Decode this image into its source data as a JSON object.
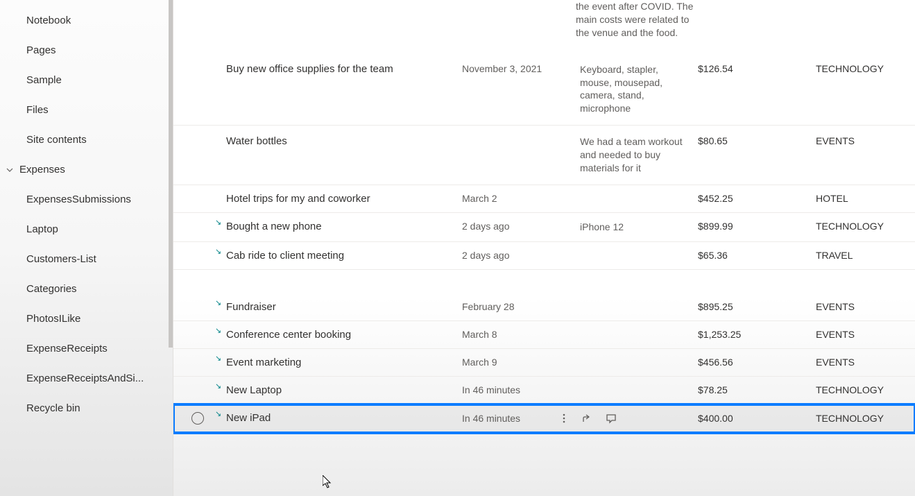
{
  "sidebar": {
    "items": [
      {
        "label": "Notebook",
        "chevron": false
      },
      {
        "label": "Pages",
        "chevron": false
      },
      {
        "label": "Sample",
        "chevron": false
      },
      {
        "label": "Files",
        "chevron": false
      },
      {
        "label": "Site contents",
        "chevron": false
      },
      {
        "label": "Expenses",
        "chevron": true
      },
      {
        "label": "ExpensesSubmissions",
        "chevron": false
      },
      {
        "label": "Laptop",
        "chevron": false
      },
      {
        "label": "Customers-List",
        "chevron": false
      },
      {
        "label": "Categories",
        "chevron": false
      },
      {
        "label": "PhotosILike",
        "chevron": false
      },
      {
        "label": "ExpenseReceipts",
        "chevron": false
      },
      {
        "label": "ExpenseReceiptsAndSi...",
        "chevron": false
      },
      {
        "label": "Recycle bin",
        "chevron": false
      }
    ]
  },
  "desc_fragment": "the event after COVID. The main costs were related to the venue and the food.",
  "rows": [
    {
      "title": "Buy new office supplies for the team",
      "date": "November 3, 2021",
      "desc": "Keyboard, stapler, mouse, mousepad, camera, stand, microphone",
      "amount": "$126.54",
      "category": "TECHNOLOGY",
      "link": false
    },
    {
      "title": "Water bottles",
      "date": "",
      "desc": "We had a team workout and needed to buy materials for it",
      "amount": "$80.65",
      "category": "EVENTS",
      "link": false
    },
    {
      "title": "Hotel trips for my and coworker",
      "date": "March 2",
      "desc": "",
      "amount": "$452.25",
      "category": "HOTEL",
      "link": false
    },
    {
      "title": "Bought a new phone",
      "date": "2 days ago",
      "desc": "iPhone 12",
      "amount": "$899.99",
      "category": "TECHNOLOGY",
      "link": true
    },
    {
      "title": "Cab ride to client meeting",
      "date": "2 days ago",
      "desc": "",
      "amount": "$65.36",
      "category": "TRAVEL",
      "link": true
    },
    {
      "title": "Fundraiser",
      "date": "February 28",
      "desc": "",
      "amount": "$895.25",
      "category": "EVENTS",
      "link": true,
      "gap": true
    },
    {
      "title": "Conference center booking",
      "date": "March 8",
      "desc": "",
      "amount": "$1,253.25",
      "category": "EVENTS",
      "link": true
    },
    {
      "title": "Event marketing",
      "date": "March 9",
      "desc": "",
      "amount": "$456.56",
      "category": "EVENTS",
      "link": true
    },
    {
      "title": "New Laptop",
      "date": "In 46 minutes",
      "desc": "",
      "amount": "$78.25",
      "category": "TECHNOLOGY",
      "link": true
    },
    {
      "title": "New iPad",
      "date": "In 46 minutes",
      "desc": "",
      "amount": "$400.00",
      "category": "TECHNOLOGY",
      "link": true,
      "selected": true
    }
  ]
}
